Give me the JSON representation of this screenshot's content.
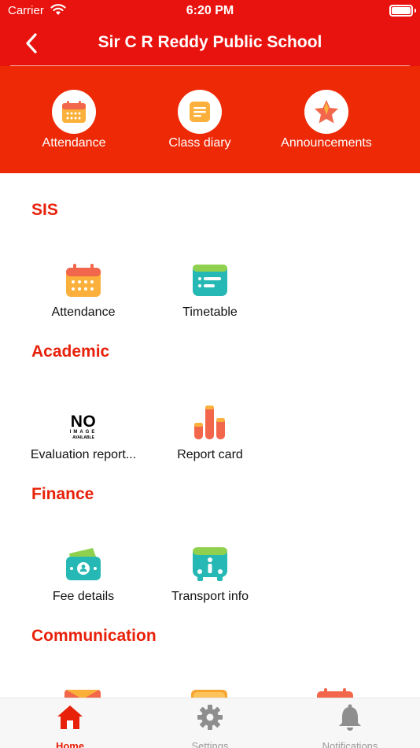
{
  "status_bar": {
    "carrier": "Carrier",
    "time": "6:20 PM"
  },
  "nav": {
    "title": "Sir C R Reddy Public School"
  },
  "quick_actions": [
    {
      "label": "Attendance",
      "icon": "calendar-icon"
    },
    {
      "label": "Class diary",
      "icon": "diary-icon"
    },
    {
      "label": "Announcements",
      "icon": "star-icon"
    }
  ],
  "sections": {
    "sis": {
      "title": "SIS",
      "items": [
        {
          "label": "Attendance",
          "icon": "calendar-icon"
        },
        {
          "label": "Timetable",
          "icon": "timetable-icon"
        }
      ]
    },
    "academic": {
      "title": "Academic",
      "items": [
        {
          "label": "Evaluation report...",
          "icon": "no-image-icon"
        },
        {
          "label": "Report card",
          "icon": "bar-chart-icon"
        }
      ],
      "no_image_text": {
        "line1": "NO",
        "line2": "IMAGE",
        "line3": "AVAILABLE"
      }
    },
    "finance": {
      "title": "Finance",
      "items": [
        {
          "label": "Fee details",
          "icon": "money-icon"
        },
        {
          "label": "Transport info",
          "icon": "bus-icon"
        }
      ]
    },
    "communication": {
      "title": "Communication"
    }
  },
  "tab_bar": {
    "active": "Home",
    "tabs": [
      {
        "label": "Home",
        "icon": "home-icon"
      },
      {
        "label": "Settings",
        "icon": "gear-icon"
      },
      {
        "label": "Notifications",
        "icon": "bell-icon"
      }
    ]
  },
  "colors": {
    "primary": "#e8130f",
    "panel": "#ee2a06",
    "section_title": "#e8210a",
    "tab_inactive": "#9b9b9b"
  }
}
